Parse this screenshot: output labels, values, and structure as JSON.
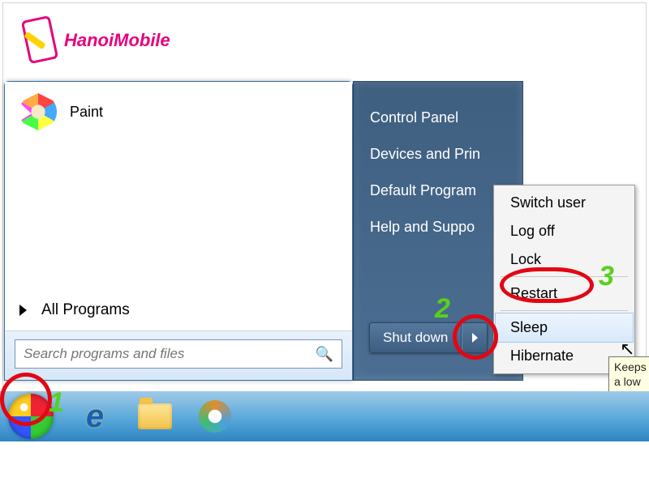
{
  "watermark": {
    "text": "HanoiMobile"
  },
  "startmenu": {
    "program": {
      "name": "Paint"
    },
    "all_programs": "All Programs",
    "search_placeholder": "Search programs and files"
  },
  "right_panel": {
    "items": [
      "Control Panel",
      "Devices and Prin",
      "Default Program",
      "Help and Suppo"
    ]
  },
  "shutdown": {
    "label": "Shut down",
    "arrow": "▶"
  },
  "flyout": {
    "items": [
      "Switch user",
      "Log off",
      "Lock",
      "Restart",
      "Sleep",
      "Hibernate"
    ],
    "hover_index": 4
  },
  "tooltip": {
    "text": "Keeps a low worki"
  },
  "annotations": {
    "n1": "1",
    "n2": "2",
    "n3": "3"
  }
}
